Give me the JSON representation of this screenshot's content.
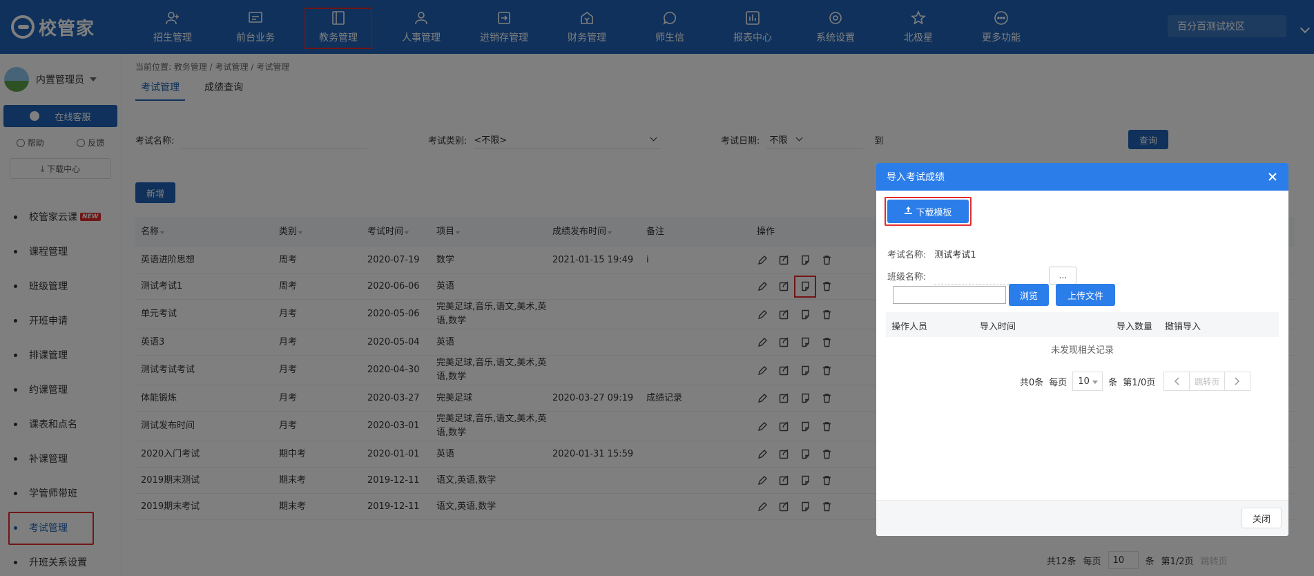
{
  "app": {
    "logo_text": "校管家",
    "campus": "百分百测试校区"
  },
  "topnav": [
    {
      "label": "招生管理",
      "icon": "person-add-icon"
    },
    {
      "label": "前台业务",
      "icon": "monitor-icon"
    },
    {
      "label": "教务管理",
      "icon": "book-icon",
      "active": true
    },
    {
      "label": "人事管理",
      "icon": "person-icon"
    },
    {
      "label": "进销存管理",
      "icon": "import-icon"
    },
    {
      "label": "财务管理",
      "icon": "finance-icon"
    },
    {
      "label": "师生信",
      "icon": "chat-icon"
    },
    {
      "label": "报表中心",
      "icon": "chart-icon"
    },
    {
      "label": "系统设置",
      "icon": "gear-icon"
    },
    {
      "label": "北极星",
      "icon": "star-icon"
    },
    {
      "label": "更多功能",
      "icon": "more-icon"
    }
  ],
  "sidebar": {
    "user": "内置管理员",
    "online_service": "在线客服",
    "help": "帮助",
    "feedback": "反馈",
    "download_center": "下载中心",
    "items": [
      {
        "label": "校管家云课",
        "badge": "NEW"
      },
      {
        "label": "课程管理"
      },
      {
        "label": "班级管理"
      },
      {
        "label": "开班申请"
      },
      {
        "label": "排课管理"
      },
      {
        "label": "约课管理"
      },
      {
        "label": "课表和点名"
      },
      {
        "label": "补课管理"
      },
      {
        "label": "学管师带班"
      },
      {
        "label": "考试管理",
        "active": true
      },
      {
        "label": "升班关系设置"
      }
    ]
  },
  "main": {
    "breadcrumb": "当前位置: 教务管理 / 考试管理 / 考试管理",
    "tabs": [
      "考试管理",
      "成绩查询"
    ],
    "filters": {
      "exam_name_label": "考试名称:",
      "exam_type_label": "考试类别:",
      "exam_type_value": "<不限>",
      "exam_date_label": "考试日期:",
      "exam_date_value": "不限",
      "to_label": "到",
      "query_button": "查询"
    },
    "add_button": "新增",
    "table": {
      "headers": [
        "名称",
        "类别",
        "考试时间",
        "项目",
        "成绩发布时间",
        "备注",
        "操作"
      ],
      "rows": [
        {
          "name": "英语进阶思想",
          "type": "周考",
          "date": "2020-07-19",
          "subjects": "数学",
          "publish": "2021-01-15 19:49",
          "note": "i"
        },
        {
          "name": "测试考试1",
          "type": "周考",
          "date": "2020-06-06",
          "subjects": "英语",
          "publish": "",
          "note": ""
        },
        {
          "name": "单元考试",
          "type": "月考",
          "date": "2020-05-06",
          "subjects": "完美足球,音乐,语文,美术,英语,数学",
          "publish": "",
          "note": ""
        },
        {
          "name": "英语3",
          "type": "月考",
          "date": "2020-05-04",
          "subjects": "英语",
          "publish": "",
          "note": ""
        },
        {
          "name": "测试考试考试",
          "type": "月考",
          "date": "2020-04-30",
          "subjects": "完美足球,音乐,语文,美术,英语,数学",
          "publish": "",
          "note": ""
        },
        {
          "name": "体能锻炼",
          "type": "月考",
          "date": "2020-03-27",
          "subjects": "完美足球",
          "publish": "2020-03-27 09:19",
          "note": "成绩记录"
        },
        {
          "name": "测试发布时间",
          "type": "月考",
          "date": "2020-03-01",
          "subjects": "完美足球,音乐,语文,美术,英语,数学",
          "publish": "",
          "note": ""
        },
        {
          "name": "2020入门考试",
          "type": "期中考",
          "date": "2020-01-01",
          "subjects": "英语",
          "publish": "2020-01-31 15:59",
          "note": ""
        },
        {
          "name": "2019期末测试",
          "type": "期末考",
          "date": "2019-12-11",
          "subjects": "语文,英语,数学",
          "publish": "",
          "note": ""
        },
        {
          "name": "2019期末考试",
          "type": "期末考",
          "date": "2019-12-11",
          "subjects": "语文,英语,数学",
          "publish": "",
          "note": ""
        }
      ]
    },
    "pager": {
      "total": "共12条",
      "per_page_label": "每页",
      "per_page": "10",
      "unit": "条",
      "page": "第1/2页",
      "jump": "跳转页"
    }
  },
  "modal": {
    "title": "导入考试成绩",
    "download_template": "下载模板",
    "exam_name_label": "考试名称:",
    "exam_name_value": "测试考试1",
    "class_name_label": "班级名称:",
    "dots": "...",
    "browse": "浏览",
    "upload": "上传文件",
    "headers": [
      "操作人员",
      "导入时间",
      "导入数量",
      "撤销导入"
    ],
    "empty": "未发现相关记录",
    "pager": {
      "total": "共0条",
      "per_page_label": "每页",
      "per_page": "10",
      "unit": "条",
      "page": "第1/0页",
      "jump": "跳转页"
    },
    "close": "关闭"
  },
  "colors": {
    "brand": "#1f63b6",
    "modal_header": "#2b7de9",
    "highlight": "#e52b2b"
  }
}
